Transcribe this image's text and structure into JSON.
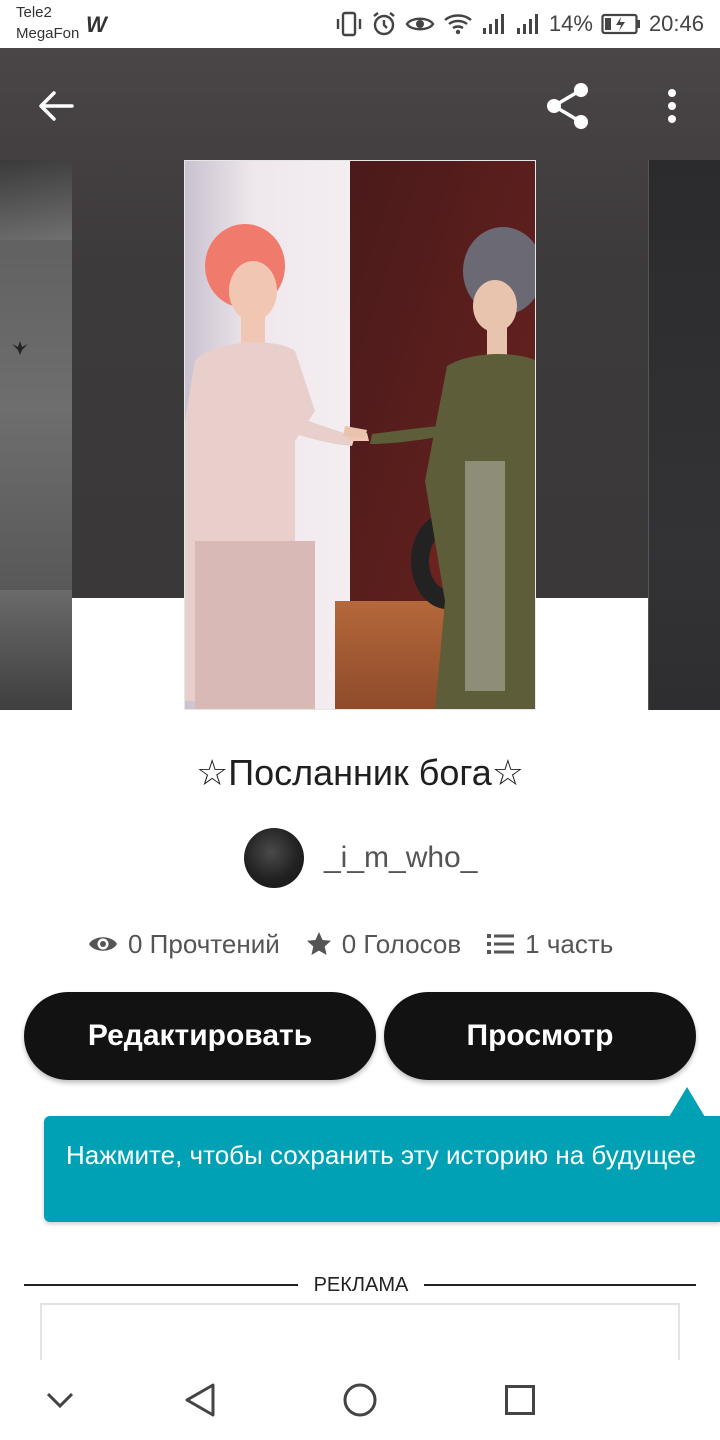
{
  "status_bar": {
    "carrier_1": "Tele2",
    "carrier_2": "MegaFon",
    "notification_icon": "W",
    "battery_percent": "14%",
    "time": "20:46"
  },
  "header": {
    "back_icon": "arrow-left-icon",
    "share_icon": "share-icon",
    "more_icon": "more-vertical-icon"
  },
  "story": {
    "title": "☆Посланник бога☆",
    "author": "_i_m_who_",
    "stats": {
      "reads": "0 Прочтений",
      "votes": "0 Голосов",
      "parts": "1 часть"
    }
  },
  "actions": {
    "edit_label": "Редактировать",
    "view_label": "Просмотр"
  },
  "tooltip": {
    "text": "Нажмите, чтобы сохранить эту историю на будущее"
  },
  "ad": {
    "label": "РЕКЛАМА"
  },
  "colors": {
    "tooltip_bg": "#00a1b5",
    "button_bg": "#121212",
    "hero_bg": "#3d3a3b"
  }
}
